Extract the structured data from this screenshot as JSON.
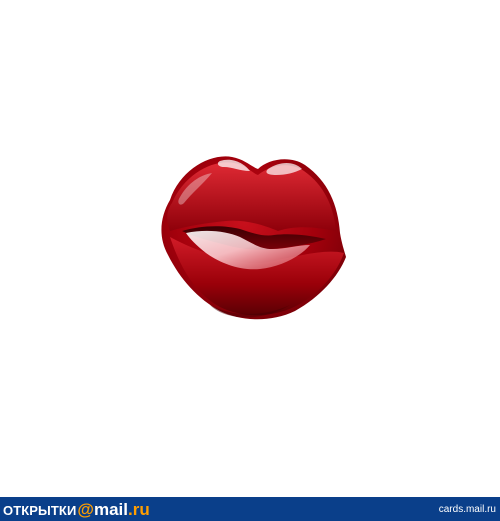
{
  "footer": {
    "brand_cards": "ОТКРЫТКИ",
    "brand_at": "@",
    "brand_mail": "mail",
    "brand_ru": ".ru",
    "site": "cards.mail.ru"
  },
  "colors": {
    "footer_bg": "#0a3f8a",
    "brand_accent": "#ff9e00",
    "lips_red": "#b0000f"
  },
  "illustration": {
    "icon": "lips-icon"
  }
}
